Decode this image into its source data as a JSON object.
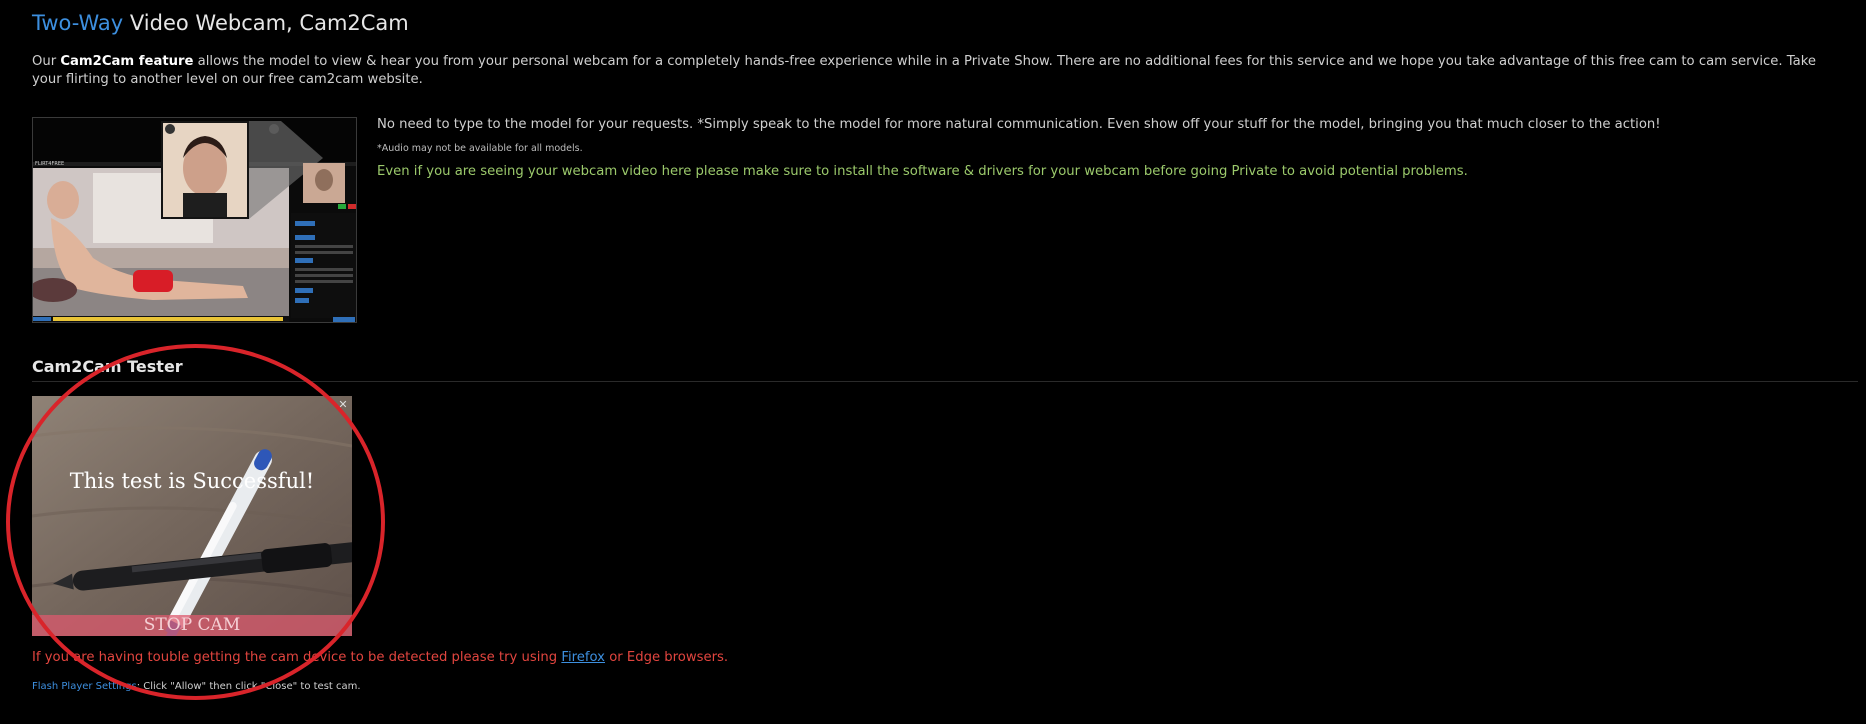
{
  "header": {
    "title_accent": "Two-Way",
    "title_rest": " Video Webcam, Cam2Cam"
  },
  "intro": {
    "prefix": "Our ",
    "bold": "Cam2Cam feature",
    "text": " allows the model to view & hear you from your personal webcam for a completely hands-free experience while in a Private Show. There are no additional fees for this service and we hope you take advantage of this free cam to cam service. Take your flirting to another level on our free cam2cam website."
  },
  "info": {
    "line1": "No need to type to the model for your requests. *Simply speak to the model for more natural communication. Even show off your stuff for the model, bringing you that much closer to the action!",
    "line2": "*Audio may not be available for all models.",
    "line3": "Even if you are seeing your webcam video here please make sure to install the software & drivers for your webcam before going Private to avoid potential problems."
  },
  "tester": {
    "section_title": "Cam2Cam Tester",
    "message": "This test is Successful!",
    "stop_label": "STOP CAM",
    "close_glyph": "✕"
  },
  "trouble": {
    "prefix": "If you are having touble getting the cam device to be detected please try using ",
    "link": "Firefox",
    "suffix": " or Edge browsers."
  },
  "flash": {
    "link": "Flash Player Settings",
    "text": ": Click \"Allow\" then click \"Close\" to test cam."
  },
  "preview": {
    "brand": "FLIRT4FREE"
  },
  "colors": {
    "accent": "#3d8fdf",
    "green": "#9bc96b",
    "warning": "#e2453f",
    "circle": "#d9242a"
  }
}
